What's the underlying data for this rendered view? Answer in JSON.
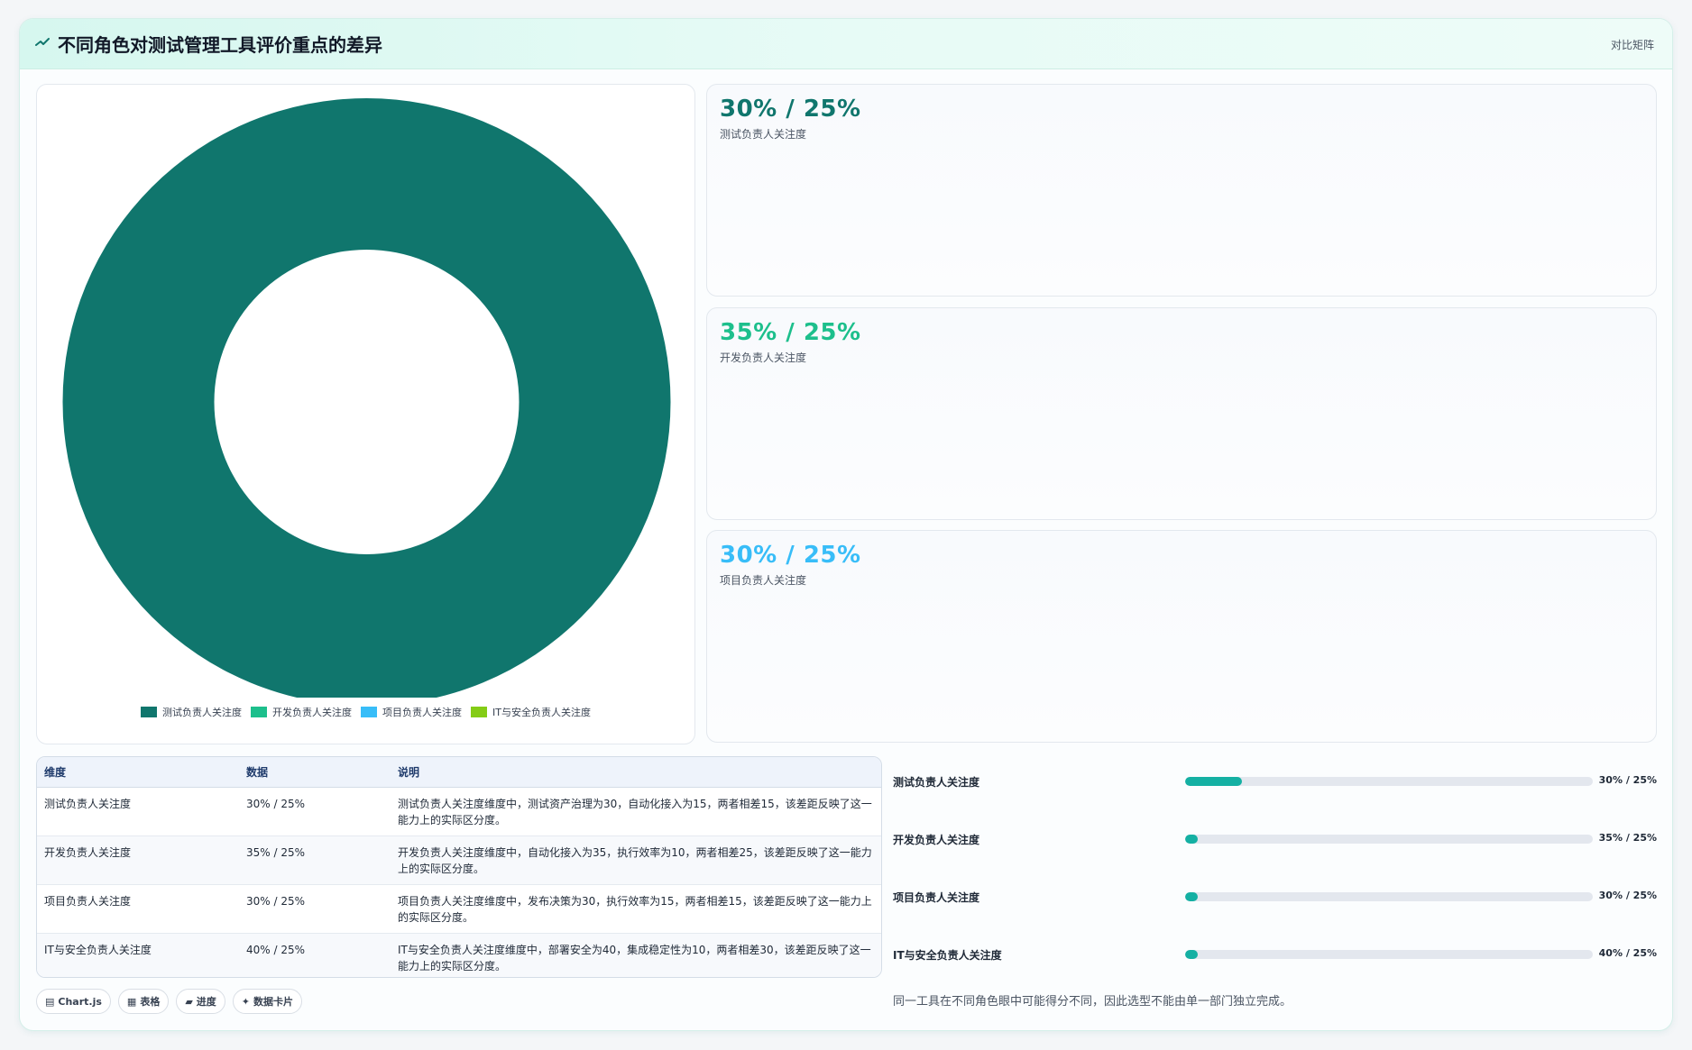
{
  "header": {
    "title": "不同角色对测试管理工具评价重点的差异",
    "tag": "对比矩阵",
    "icon": "trend-line-icon"
  },
  "chart_data": {
    "type": "pie",
    "categories": [
      "测试负责人关注度",
      "开发负责人关注度",
      "项目负责人关注度",
      "IT与安全负责人关注度"
    ],
    "values": [
      100,
      0,
      0,
      0
    ],
    "colors": [
      "#10766d",
      "#1dbf8c",
      "#38bdf8",
      "#84cc16"
    ],
    "donut": true,
    "legend_position": "bottom"
  },
  "stats": [
    {
      "value": "30% / 25%",
      "label": "测试负责人关注度",
      "color": "#10766d"
    },
    {
      "value": "35% / 25%",
      "label": "开发负责人关注度",
      "color": "#1dbf8c"
    },
    {
      "value": "30% / 25%",
      "label": "项目负责人关注度",
      "color": "#38bdf8"
    }
  ],
  "table": {
    "headers": [
      "维度",
      "数据",
      "说明"
    ],
    "rows": [
      [
        "测试负责人关注度",
        "30% / 25%",
        "测试负责人关注度维度中，测试资产治理为30，自动化接入为15，两者相差15，该差距反映了这一能力上的实际区分度。"
      ],
      [
        "开发负责人关注度",
        "35% / 25%",
        "开发负责人关注度维度中，自动化接入为35，执行效率为10，两者相差25，该差距反映了这一能力上的实际区分度。"
      ],
      [
        "项目负责人关注度",
        "30% / 25%",
        "项目负责人关注度维度中，发布决策为30，执行效率为15，两者相差15，该差距反映了这一能力上的实际区分度。"
      ],
      [
        "IT与安全负责人关注度",
        "40% / 25%",
        "IT与安全负责人关注度维度中，部署安全为40，集成稳定性为10，两者相差30，该差距反映了这一能力上的实际区分度。"
      ]
    ]
  },
  "pills": [
    {
      "icon": "▤",
      "label": "Chart.js"
    },
    {
      "icon": "▦",
      "label": "表格"
    },
    {
      "icon": "▰",
      "label": "进度"
    },
    {
      "icon": "✦",
      "label": "数据卡片"
    }
  ],
  "progress": [
    {
      "label": "测试负责人关注度",
      "value": "30% / 25%",
      "fill": 0.14
    },
    {
      "label": "开发负责人关注度",
      "value": "35% / 25%",
      "fill": 0.03
    },
    {
      "label": "项目负责人关注度",
      "value": "30% / 25%",
      "fill": 0.03
    },
    {
      "label": "IT与安全负责人关注度",
      "value": "40% / 25%",
      "fill": 0.03
    }
  ],
  "note": "同一工具在不同角色眼中可能得分不同，因此选型不能由单一部门独立完成。"
}
